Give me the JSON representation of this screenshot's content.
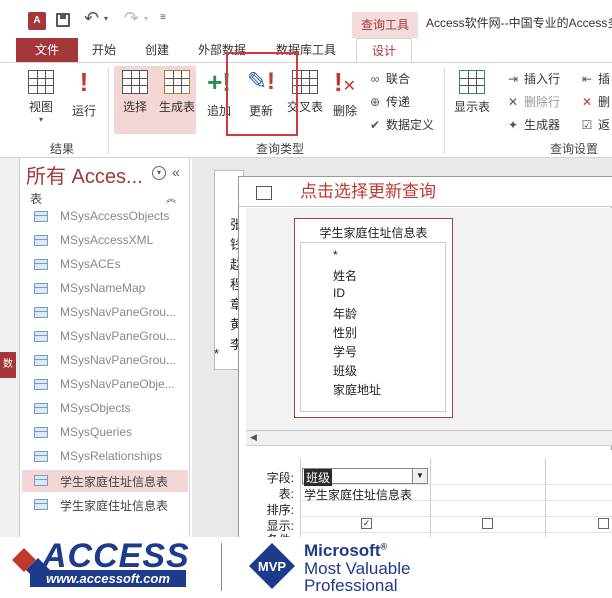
{
  "titlebar": {
    "app_icon_label": "A",
    "context_tab": "查询工具",
    "window_title": "Access软件网--中国专业的Access多"
  },
  "ribbon_tabs": [
    "文件",
    "开始",
    "创建",
    "外部数据",
    "数据库工具",
    "设计"
  ],
  "ribbon": {
    "results": {
      "view": "视图",
      "run": "运行",
      "group": "结果"
    },
    "query_type": {
      "select": "选择",
      "make_table": "生成表",
      "append": "追加",
      "update": "更新",
      "crosstab": "交叉表",
      "delete": "删除",
      "union": "联合",
      "passthrough": "传递",
      "data_definition": "数据定义",
      "group": "查询类型"
    },
    "query_setup": {
      "show_table": "显示表",
      "insert_rows": "插入行",
      "delete_rows": "删除行",
      "builder": "生成器",
      "insert_cols": "插",
      "delete_cols": "删",
      "return": "返",
      "group": "查询设置"
    }
  },
  "nav": {
    "title": "所有 Acces...",
    "group": "表",
    "items": [
      "MSysAccessObjects",
      "MSysAccessXML",
      "MSysACEs",
      "MSysNameMap",
      "MSysNavPaneGrou...",
      "MSysNavPaneGrou...",
      "MSysNavPaneGrou...",
      "MSysNavPaneObje...",
      "MSysObjects",
      "MSysQueries",
      "MSysRelationships",
      "学生家庭住址信息表",
      "学生家庭住址信息表"
    ]
  },
  "left_strip": {
    "label": "数"
  },
  "background_table": {
    "rows": [
      "张",
      "钱",
      "赵",
      "程",
      "章",
      "黄",
      "李",
      "*"
    ]
  },
  "annotation": "点击选择更新查询",
  "query": {
    "table_name": "学生家庭住址信息表",
    "fields": [
      "*",
      "姓名",
      "ID",
      "年龄",
      "性别",
      "学号",
      "班级",
      "家庭地址"
    ],
    "grid": {
      "labels": [
        "字段:",
        "表:",
        "排序:",
        "显示:",
        "条件:"
      ],
      "field_value": "班级",
      "table_value": "学生家庭住址信息表"
    }
  },
  "footer": {
    "brand": "ACCESS",
    "url": "www.accessoft.com",
    "mvp_badge": "MVP",
    "ms_line1": "Microsoft",
    "ms_line2": "Most Valuable",
    "ms_line3": "Professional"
  }
}
